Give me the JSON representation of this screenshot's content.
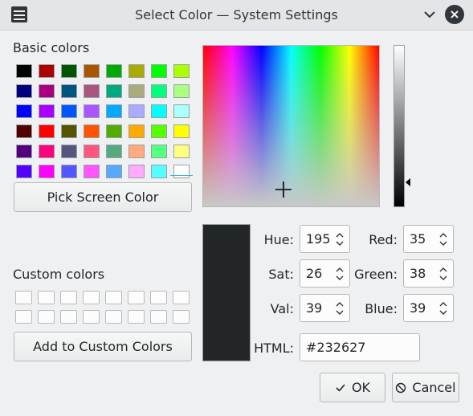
{
  "window": {
    "title": "Select Color — System Settings"
  },
  "basic_colors": {
    "label": "Basic colors",
    "rows": [
      [
        "#000000",
        "#aa0000",
        "#005500",
        "#aa5500",
        "#00aa00",
        "#aaaa00",
        "#00ff00",
        "#aaff00"
      ],
      [
        "#00007f",
        "#aa007f",
        "#00557f",
        "#aa557f",
        "#00aa7f",
        "#aaaa7f",
        "#00ff7f",
        "#aaff7f"
      ],
      [
        "#0000ff",
        "#aa00ff",
        "#0055ff",
        "#aa55ff",
        "#00aaff",
        "#aaaaff",
        "#00ffff",
        "#aaffff"
      ],
      [
        "#550000",
        "#ff0000",
        "#555500",
        "#ff5500",
        "#55aa00",
        "#ffaa00",
        "#55ff00",
        "#ffff00"
      ],
      [
        "#55007f",
        "#ff007f",
        "#55557f",
        "#ff557f",
        "#55aa7f",
        "#ffaa7f",
        "#55ff7f",
        "#ffff7f"
      ],
      [
        "#5500ff",
        "#ff00ff",
        "#5555ff",
        "#ff55ff",
        "#55aaff",
        "#ffaaff",
        "#55ffff",
        "#ffffff"
      ]
    ]
  },
  "pick_screen_label": "Pick Screen Color",
  "custom_colors": {
    "label": "Custom colors",
    "rows": 2,
    "cols": 8
  },
  "add_custom_label": "Add to Custom Colors",
  "fields": {
    "hue": {
      "label": "Hue:",
      "value": "195"
    },
    "sat": {
      "label": "Sat:",
      "value": "26"
    },
    "val": {
      "label": "Val:",
      "value": "39"
    },
    "red": {
      "label": "Red:",
      "value": "35"
    },
    "green": {
      "label": "Green:",
      "value": "38"
    },
    "blue": {
      "label": "Blue:",
      "value": "39"
    },
    "html": {
      "label": "HTML:",
      "value": "#232627"
    }
  },
  "current_color": "#232627",
  "buttons": {
    "ok": "OK",
    "cancel": "Cancel"
  },
  "icons": {
    "ok": "check-icon",
    "cancel": "cancel-circle-icon",
    "window": "settings-sliders-icon"
  }
}
